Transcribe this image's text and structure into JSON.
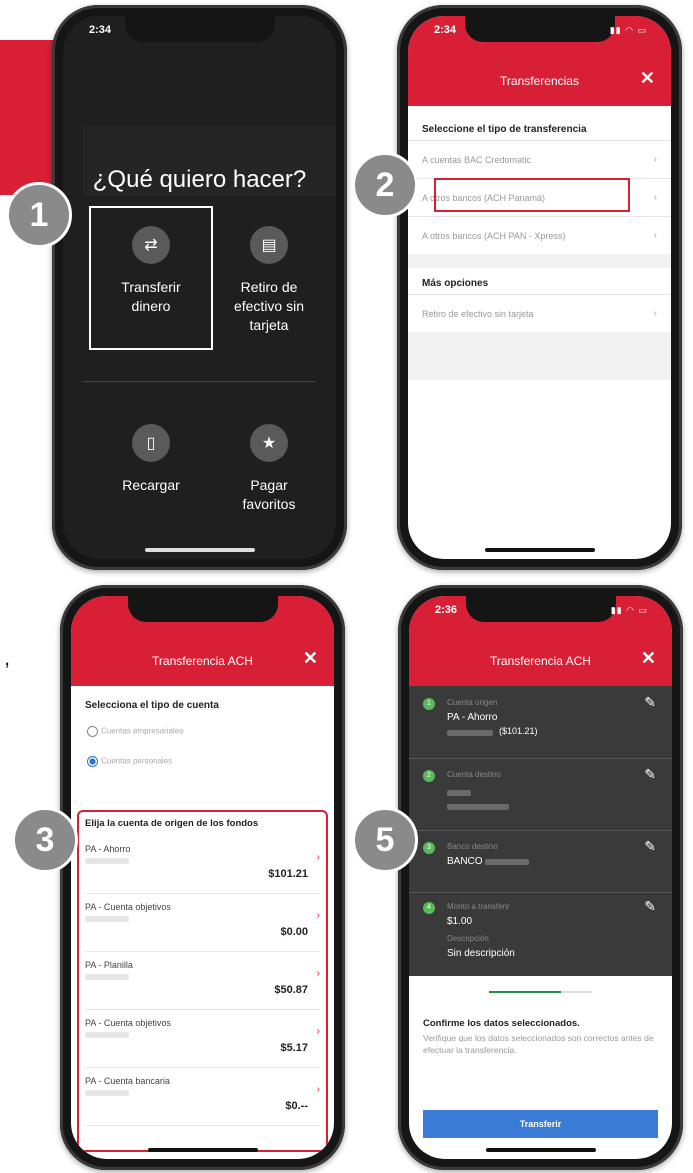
{
  "left_text": ",",
  "badges": [
    "1",
    "2",
    "3",
    "5"
  ],
  "phone1": {
    "time": "2:34",
    "title": "¿Qué quiero hacer?",
    "tiles": [
      {
        "icon": "⇄",
        "icon_name": "transfer-arrows-icon",
        "label": "Transferir\ndinero"
      },
      {
        "icon": "▤",
        "icon_name": "atm-icon",
        "label": "Retiro de\nefectivo sin\ntarjeta"
      },
      {
        "icon": "▯",
        "icon_name": "phone-icon",
        "label": "Recargar"
      },
      {
        "icon": "★",
        "icon_name": "star-icon",
        "label": "Pagar\nfavoritos"
      }
    ]
  },
  "phone2": {
    "time": "2:34",
    "header_title": "Transferencias",
    "close": "✕",
    "section1": "Seleccione el tipo de transferencia",
    "options": [
      "A cuentas BAC Credomatic",
      "A otros bancos (ACH Panamá)",
      "A otros bancos (ACH PAN - Xpress)"
    ],
    "section2": "Más opciones",
    "more": [
      "Retiro de efectivo sin tarjeta"
    ]
  },
  "phone3": {
    "header_title": "Transferencia ACH",
    "close": "✕",
    "account_type_heading": "Selecciona el tipo de cuenta",
    "radio_options": [
      "Cuentas empresariales",
      "Cuentas personales"
    ],
    "selected_radio": 1,
    "origin_heading": "Elija la cuenta de origen de los fondos",
    "accounts": [
      {
        "name": "PA - Ahorro",
        "amount": "$101.21"
      },
      {
        "name": "PA - Cuenta objetivos",
        "amount": "$0.00"
      },
      {
        "name": "PA - Planilla",
        "amount": "$50.87"
      },
      {
        "name": "PA - Cuenta objetivos",
        "amount": "$5.17"
      },
      {
        "name": "PA - Cuenta bancaria",
        "amount": "$0.--"
      }
    ]
  },
  "phone4": {
    "time": "2:36",
    "header_title": "Transferencia ACH",
    "close": "✕",
    "steps": [
      {
        "num": "1",
        "label": "Cuenta origen",
        "value": "PA - Ahorro",
        "sub": "($101.21)"
      },
      {
        "num": "2",
        "label": "Cuenta destino",
        "value": "",
        "sub": ""
      },
      {
        "num": "3",
        "label": "Banco destino",
        "value": "BANCO",
        "sub": ""
      },
      {
        "num": "4",
        "label": "Monto a transferir",
        "value": "$1.00",
        "desc_label": "Descripción",
        "desc": "Sin descripción"
      }
    ],
    "confirm_title": "Confirme los datos seleccionados.",
    "confirm_sub": "Verifique que los datos seleccionados son correctos antes de efectuar la transferencia.",
    "button": "Transferir"
  },
  "colors": {
    "brand_red": "#d81f36",
    "button_blue": "#3a7bd5",
    "step_green": "#5cb85c"
  }
}
